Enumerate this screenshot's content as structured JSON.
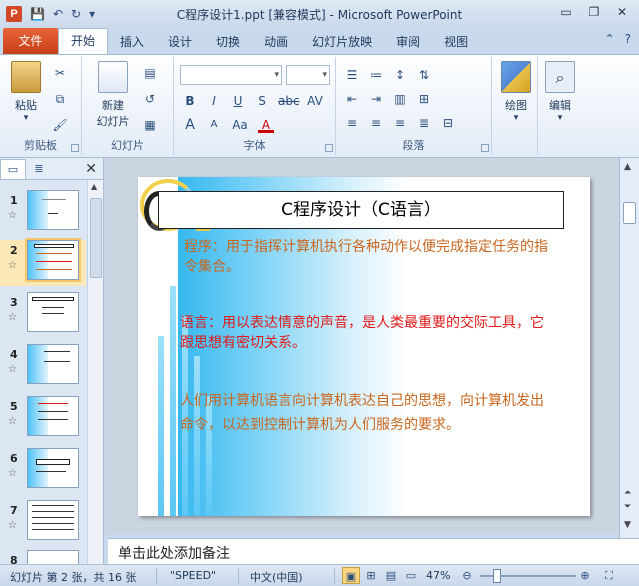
{
  "window": {
    "app_icon_letter": "P",
    "title": "C程序设计1.ppt [兼容模式] - Microsoft PowerPoint"
  },
  "qat": {
    "save_icon": "save-icon",
    "undo_icon": "undo-icon",
    "redo_icon": "redo-icon"
  },
  "tabs": {
    "file": "文件",
    "items": [
      "开始",
      "插入",
      "设计",
      "切换",
      "动画",
      "幻灯片放映",
      "审阅",
      "视图"
    ]
  },
  "ribbon": {
    "clipboard": {
      "paste": "粘贴",
      "label": "剪贴板"
    },
    "slides": {
      "new_slide_line1": "新建",
      "new_slide_line2": "幻灯片",
      "label": "幻灯片"
    },
    "font": {
      "label": "字体",
      "bold": "B",
      "italic": "I",
      "underline": "U",
      "shadow": "S",
      "strike": "abc",
      "char_spacing": "AV",
      "grow": "A",
      "shrink": "A",
      "change_case": "Aa",
      "font_color": "A"
    },
    "paragraph": {
      "label": "段落"
    },
    "drawing": {
      "label": "绘图"
    },
    "editing": {
      "label": "编辑"
    }
  },
  "left_panel": {
    "slide_numbers": [
      "1",
      "2",
      "3",
      "4",
      "5",
      "6",
      "7",
      "8"
    ],
    "selected": "2"
  },
  "slide": {
    "title": "C程序设计（C语言）",
    "p1": "程序：用于指挥计算机执行各种动作以便完成指定任务的指令集合。",
    "p2": "语言：用以表达情意的声音，是人类最重要的交际工具，它跟思想有密切关系。",
    "p3": "人们用计算机语言向计算机表达自己的思想，向计算机发出命令，以达到控制计算机为人们服务的要求。"
  },
  "notes": {
    "placeholder": "单击此处添加备注"
  },
  "status": {
    "slide_info": "幻灯片 第 2 张，共 16 张",
    "theme": "\"SPEED\"",
    "language": "中文(中国)",
    "zoom": "47%",
    "zoom_fraction": 0.47
  },
  "colors": {
    "file_tab": "#d24726",
    "orange_text": "#c9661d",
    "red_text": "#e01818",
    "slide_blue": "#36b8f0"
  }
}
